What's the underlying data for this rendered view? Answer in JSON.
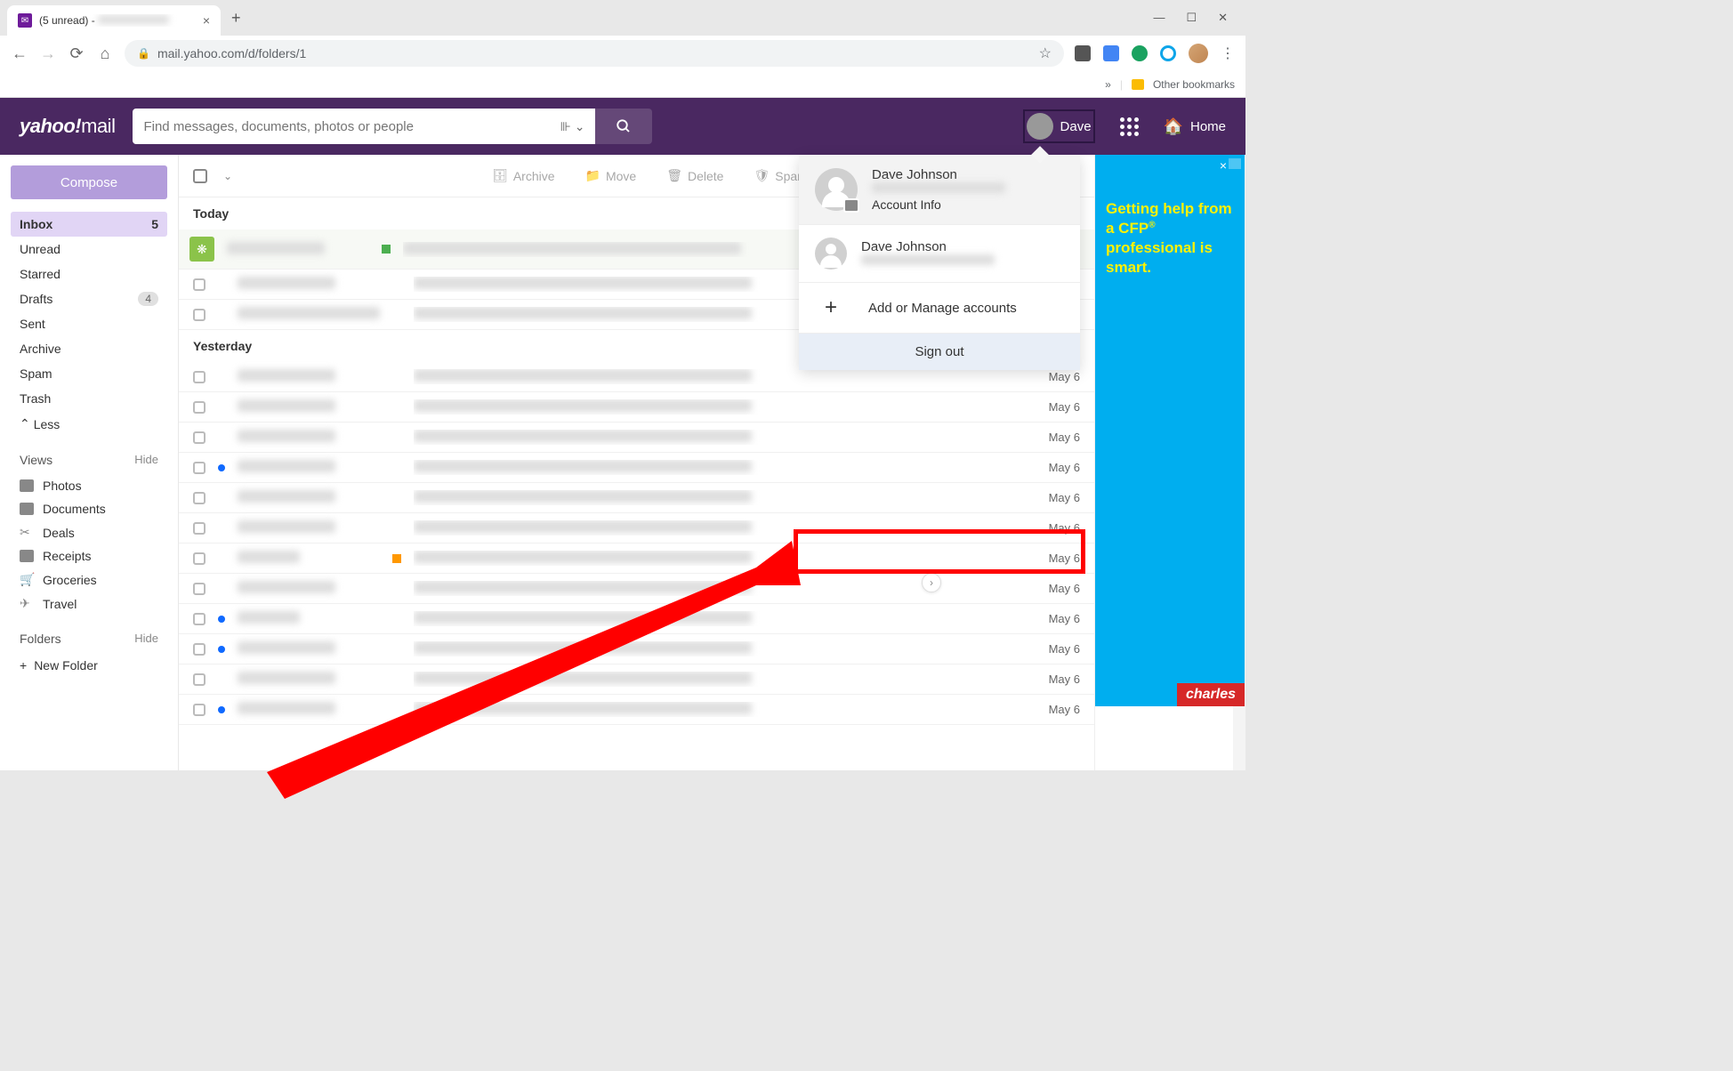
{
  "browser": {
    "tab_title": "(5 unread) -",
    "url": "mail.yahoo.com/d/folders/1",
    "bookmarks_label": "Other bookmarks"
  },
  "header": {
    "logo_brand": "yahoo",
    "logo_product": "mail",
    "search_placeholder": "Find messages, documents, photos or people",
    "user_name": "Dave",
    "home_label": "Home"
  },
  "sidebar": {
    "compose": "Compose",
    "folders": [
      {
        "label": "Inbox",
        "count": "5",
        "active": true
      },
      {
        "label": "Unread"
      },
      {
        "label": "Starred"
      },
      {
        "label": "Drafts",
        "count": "4",
        "badge": true
      },
      {
        "label": "Sent"
      },
      {
        "label": "Archive"
      },
      {
        "label": "Spam"
      },
      {
        "label": "Trash"
      }
    ],
    "less": "Less",
    "views_header": "Views",
    "hide": "Hide",
    "views": [
      {
        "label": "Photos"
      },
      {
        "label": "Documents"
      },
      {
        "label": "Deals"
      },
      {
        "label": "Receipts"
      },
      {
        "label": "Groceries"
      },
      {
        "label": "Travel"
      }
    ],
    "folders_header": "Folders",
    "new_folder": "New Folder"
  },
  "toolbar": {
    "archive": "Archive",
    "move": "Move",
    "delete": "Delete",
    "spam": "Spam"
  },
  "messages": {
    "today": "Today",
    "yesterday": "Yesterday",
    "date_may6": "May 6"
  },
  "account_menu": {
    "primary_name": "Dave Johnson",
    "account_info": "Account Info",
    "secondary_name": "Dave Johnson",
    "add_manage": "Add or Manage accounts",
    "sign_out": "Sign out"
  },
  "ad": {
    "line1": "Getting help from a CFP",
    "line2": "professional is smart.",
    "brand": "charles"
  }
}
